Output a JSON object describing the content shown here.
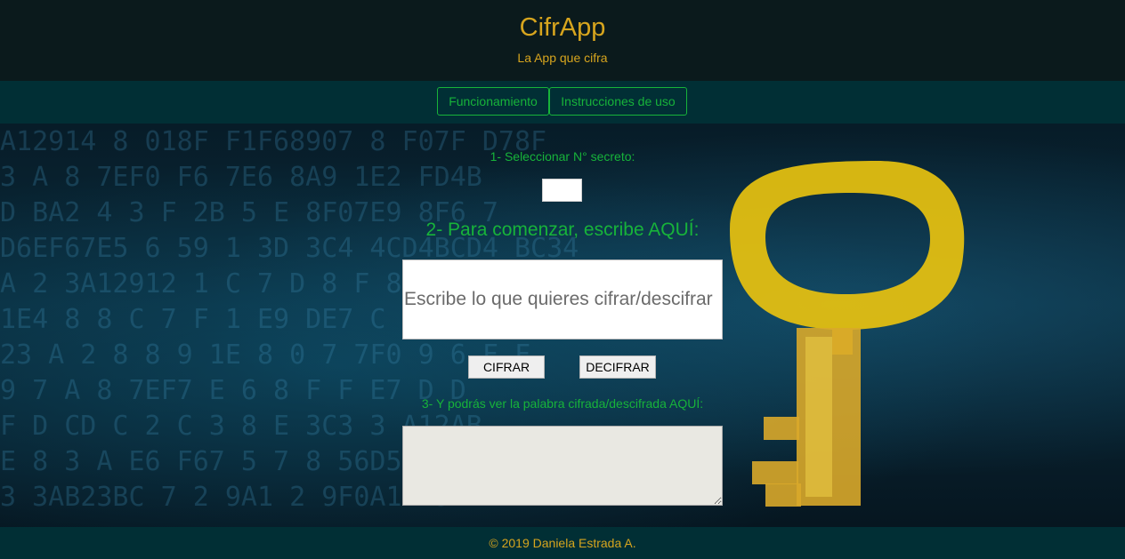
{
  "header": {
    "title": "CifrApp",
    "subtitle": "La App que cifra"
  },
  "nav": {
    "items": [
      "Funcionamiento",
      "Instrucciones de uso"
    ]
  },
  "form": {
    "step1_label": "1- Seleccionar N° secreto:",
    "secret_value": "",
    "step2_label": "2- Para comenzar, escribe AQUÍ:",
    "text_placeholder": "Escribe lo que quieres cifrar/descifrar",
    "text_value": "",
    "cifrar_label": "CIFRAR",
    "decifrar_label": "DECIFRAR",
    "step3_label": "3- Y podrás ver la palabra cifrada/descifrada AQUÍ:",
    "output_value": ""
  },
  "footer": {
    "copyright": "© 2019 Daniela Estrada A."
  },
  "background": {
    "image": "hex-digits-with-golden-key",
    "hex_rows": [
      "A12914 8 018F  F1F68907 8  F07F D78F",
      "3 A 8 7EF0  F6 7E6 8A9 1E2 FD4B",
      "  D BA2 4 3 F  2B 5 E 8F07E9 8F6 7",
      "D6EF67E5 6 59 1 3D 3C4 4CD4BCD4 BC34",
      "  A 2 3A12912 1 C 7 D 8 F 8F0 F6 8F",
      "1E4 8 8 C 7  F 1 E9 DE7 C  7  C",
      "23 A 2 8 8 9 1E 8 0 7 7F0  9 6 F  F",
      " 9 7 A 8 7EF7 E 6 8 F F  E7 D D",
      "F D CD C 2 C 3 8 E 3C3 3 A12AB",
      "E 8 3 A E6 F67 5 7 8 56D5 6D",
      "3 3AB23BC 7 2 9A1 2 9F0A12 3"
    ]
  },
  "colors": {
    "header_bg": "#0b1a1c",
    "nav_bg": "#012f35",
    "accent_gold": "#d7a51e",
    "accent_green": "#17b33a",
    "key_gold": "#e8c20f"
  }
}
